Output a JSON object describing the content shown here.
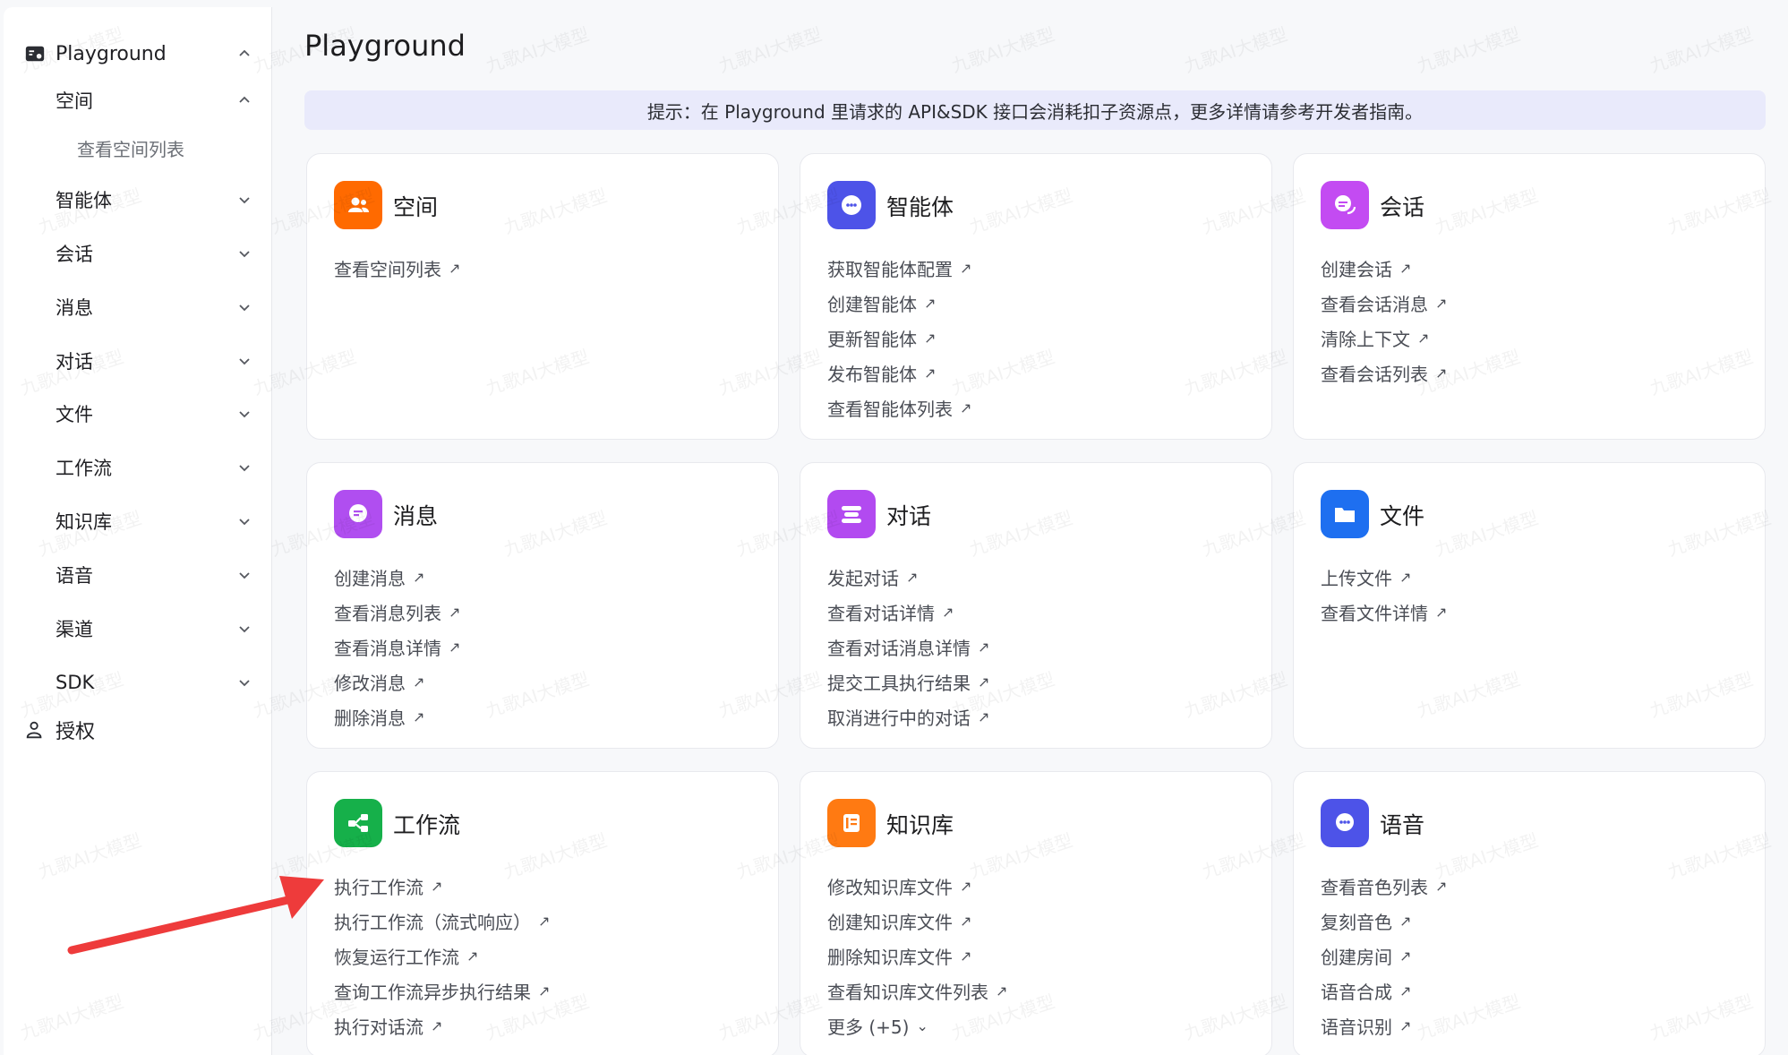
{
  "sidebar": {
    "items": [
      {
        "label": "Playground",
        "level": 0,
        "expanded": true,
        "icon": "playground-icon"
      },
      {
        "label": "空间",
        "level": 1,
        "expanded": true
      },
      {
        "label": "查看空间列表",
        "level": 2
      },
      {
        "label": "智能体",
        "level": 1,
        "expanded": false
      },
      {
        "label": "会话",
        "level": 1,
        "expanded": false
      },
      {
        "label": "消息",
        "level": 1,
        "expanded": false
      },
      {
        "label": "对话",
        "level": 1,
        "expanded": false
      },
      {
        "label": "文件",
        "level": 1,
        "expanded": false
      },
      {
        "label": "工作流",
        "level": 1,
        "expanded": false
      },
      {
        "label": "知识库",
        "level": 1,
        "expanded": false
      },
      {
        "label": "语音",
        "level": 1,
        "expanded": false
      },
      {
        "label": "渠道",
        "level": 1,
        "expanded": false
      },
      {
        "label": "SDK",
        "level": 1,
        "expanded": false
      },
      {
        "label": "授权",
        "level": 0,
        "icon": "auth-icon"
      }
    ]
  },
  "main": {
    "title": "Playground",
    "tip": "提示：在 Playground 里请求的 API&SDK 接口会消耗扣子资源点，更多详情请参考开发者指南。",
    "link_arrow": "↗",
    "more_chevron": "⌄",
    "cards": [
      {
        "title": "空间",
        "icon": "users-icon",
        "color": "#ff6a00",
        "links": [
          "查看空间列表"
        ]
      },
      {
        "title": "智能体",
        "icon": "bot-icon",
        "color": "#4d53e8",
        "links": [
          "获取智能体配置",
          "创建智能体",
          "更新智能体",
          "发布智能体",
          "查看智能体列表"
        ]
      },
      {
        "title": "会话",
        "icon": "chat-bubbles-icon",
        "color": "#c34bf2",
        "links": [
          "创建会话",
          "查看会话消息",
          "清除上下文",
          "查看会话列表"
        ]
      },
      {
        "title": "消息",
        "icon": "message-icon",
        "color": "#b04ef0",
        "links": [
          "创建消息",
          "查看消息列表",
          "查看消息详情",
          "修改消息",
          "删除消息"
        ]
      },
      {
        "title": "对话",
        "icon": "dialog-icon",
        "color": "#b24af0",
        "links": [
          "发起对话",
          "查看对话详情",
          "查看对话消息详情",
          "提交工具执行结果",
          "取消进行中的对话"
        ]
      },
      {
        "title": "文件",
        "icon": "folder-icon",
        "color": "#1e6ff0",
        "links": [
          "上传文件",
          "查看文件详情"
        ]
      },
      {
        "title": "工作流",
        "icon": "workflow-icon",
        "color": "#16b04a",
        "links": [
          "执行工作流",
          "执行工作流（流式响应）",
          "恢复运行工作流",
          "查询工作流异步执行结果",
          "执行对话流"
        ]
      },
      {
        "title": "知识库",
        "icon": "knowledge-icon",
        "color": "#ff7a12",
        "links": [
          "修改知识库文件",
          "创建知识库文件",
          "删除知识库文件",
          "查看知识库文件列表",
          "更多 (+5)"
        ]
      },
      {
        "title": "语音",
        "icon": "voice-icon",
        "color": "#4d53e8",
        "links": [
          "查看音色列表",
          "复刻音色",
          "创建房间",
          "语音合成",
          "语音识别"
        ]
      }
    ]
  },
  "annotation": {
    "icon": "red-arrow-icon",
    "color": "#ee3b3b"
  },
  "watermark": {
    "text": "九歌AI大模型"
  }
}
